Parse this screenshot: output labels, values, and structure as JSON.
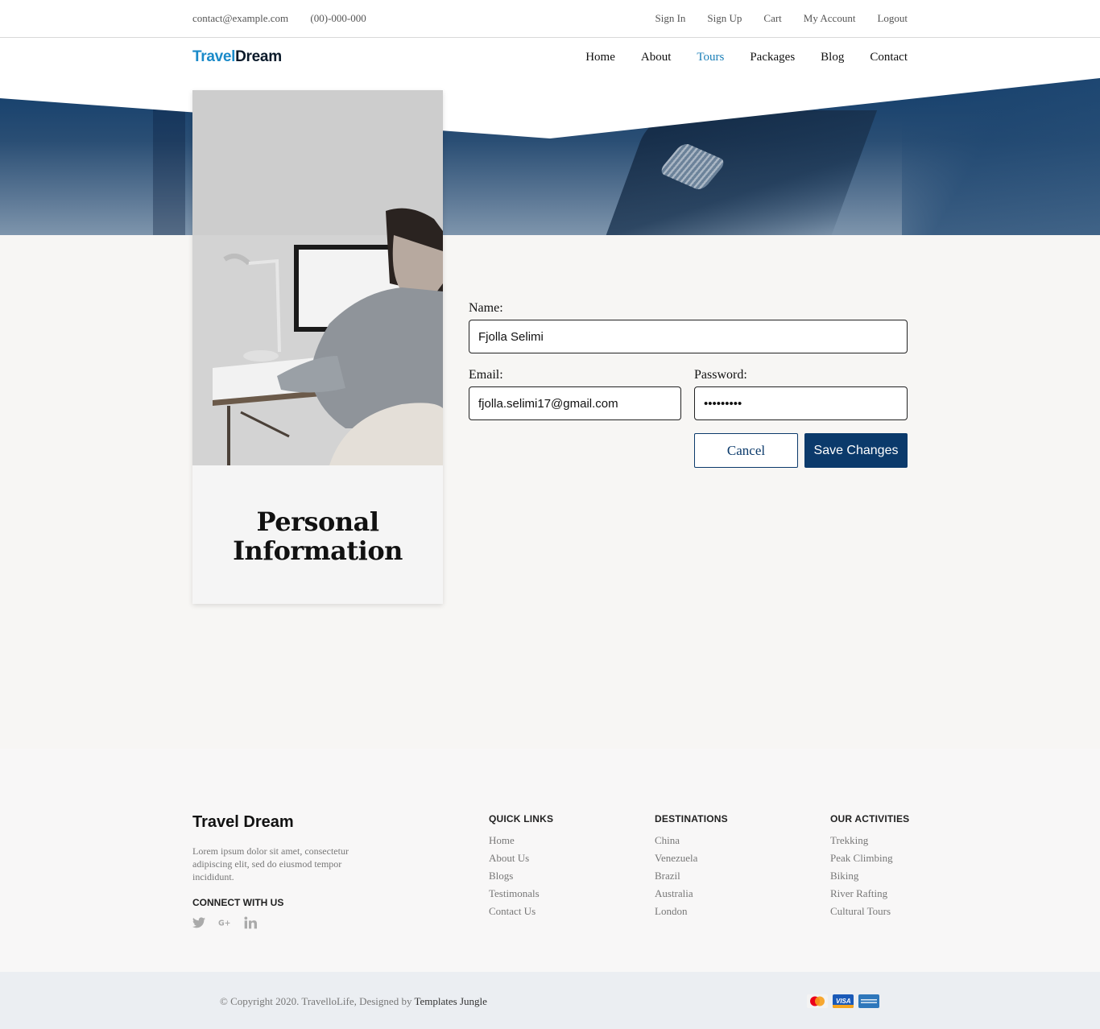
{
  "topbar": {
    "email": "contact@example.com",
    "phone": "(00)-000-000",
    "links": [
      "Sign In",
      "Sign Up",
      "Cart",
      "My Account",
      "Logout"
    ]
  },
  "brand": {
    "part1": "Travel",
    "part2": "Dream"
  },
  "nav": {
    "items": [
      "Home",
      "About",
      "Tours",
      "Packages",
      "Blog",
      "Contact"
    ],
    "active": "Tours"
  },
  "card": {
    "title_line1": "Personal",
    "title_line2": "Information"
  },
  "form": {
    "name_label": "Name:",
    "name_value": "Fjolla Selimi",
    "email_label": "Email:",
    "email_value": "fjolla.selimi17@gmail.com",
    "password_label": "Password:",
    "password_value": "selimi123",
    "cancel_label": "Cancel",
    "save_label": "Save Changes"
  },
  "footer": {
    "brand": "Travel Dream",
    "description": "Lorem ipsum dolor sit amet, consectetur adipiscing elit, sed do eiusmod tempor incididunt.",
    "connect_title": "CONNECT WITH US",
    "socials": [
      "twitter-icon",
      "google-plus-icon",
      "linkedin-icon"
    ],
    "quick_links": {
      "title": "QUICK LINKS",
      "items": [
        "Home",
        "About Us",
        "Blogs",
        "Testimonals",
        "Contact Us"
      ]
    },
    "destinations": {
      "title": "DESTINATIONS",
      "items": [
        "China",
        "Venezuela",
        "Brazil",
        "Australia",
        "London"
      ]
    },
    "activities": {
      "title": "OUR ACTIVITIES",
      "items": [
        "Trekking",
        "Peak Climbing",
        "Biking",
        "River Rafting",
        "Cultural Tours"
      ]
    },
    "copyright": "© Copyright 2020. TravelloLife, Designed by",
    "designer": "Templates Jungle",
    "payment_icons": [
      "mastercard-icon",
      "visa-icon",
      "amex-icon"
    ]
  },
  "colors": {
    "accent": "#0b3a6b",
    "brand_blue": "#1a8ac9",
    "active_nav": "#1a7fb8"
  }
}
